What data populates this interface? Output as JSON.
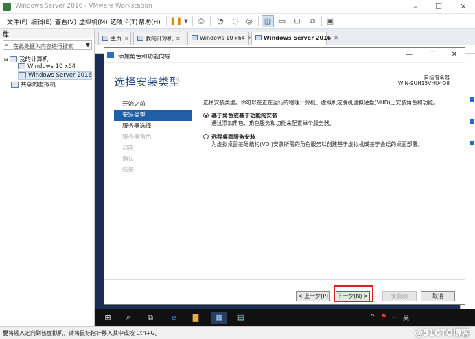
{
  "window": {
    "title": "Windows Server 2016 - VMware Workstation"
  },
  "menu": [
    "文件(F)",
    "编辑(E)",
    "查看(V)",
    "虚拟机(M)",
    "选项卡(T)",
    "帮助(H)"
  ],
  "library": {
    "title": "库",
    "search_placeholder": "在此处键入内容进行搜索",
    "tree": {
      "root": "我的计算机",
      "children": [
        "Windows 10 x64",
        "Windows Server 2016"
      ],
      "shared": "共享的虚拟机"
    }
  },
  "tabs": [
    "主页",
    "我的计算机",
    "Windows 10 x64",
    "Windows Server 2016"
  ],
  "wizard": {
    "title": "添加角色和功能向导",
    "heading": "选择安装类型",
    "server_label": "目标服务器",
    "server_name": "WIN-9UH15VHU4O8",
    "steps": [
      {
        "label": "开始之前",
        "state": "normal"
      },
      {
        "label": "安装类型",
        "state": "active"
      },
      {
        "label": "服务器选择",
        "state": "normal"
      },
      {
        "label": "服务器角色",
        "state": "disabled"
      },
      {
        "label": "功能",
        "state": "disabled"
      },
      {
        "label": "确认",
        "state": "disabled"
      },
      {
        "label": "结果",
        "state": "disabled"
      }
    ],
    "intro": "选择安装类型。你可以在正在运行的物理计算机、虚拟机或脱机虚拟硬盘(VHD)上安装角色和功能。",
    "options": [
      {
        "title": "基于角色或基于功能的安装",
        "desc": "通过添加角色、角色服务和功能来配置单个服务器。",
        "selected": true
      },
      {
        "title": "远程桌面服务安装",
        "desc": "为虚拟桌面基础结构(VDI)安装所需的角色服务以创建基于虚拟机或基于会话的桌面部署。",
        "selected": false
      }
    ],
    "buttons": {
      "back": "< 上一步(P)",
      "next": "下一步(N) >",
      "install": "安装(I)",
      "cancel": "取消"
    }
  },
  "taskbar": {
    "ime": "英"
  },
  "status": {
    "text": "要将输入定向到该虚拟机，请将鼠标指针移入其中或按 Ctrl+G。",
    "watermark": "@51CTO博客"
  },
  "colors": {
    "accent": "#1f5fa7",
    "heading": "#2b4f86",
    "highlight": "#e02020"
  }
}
